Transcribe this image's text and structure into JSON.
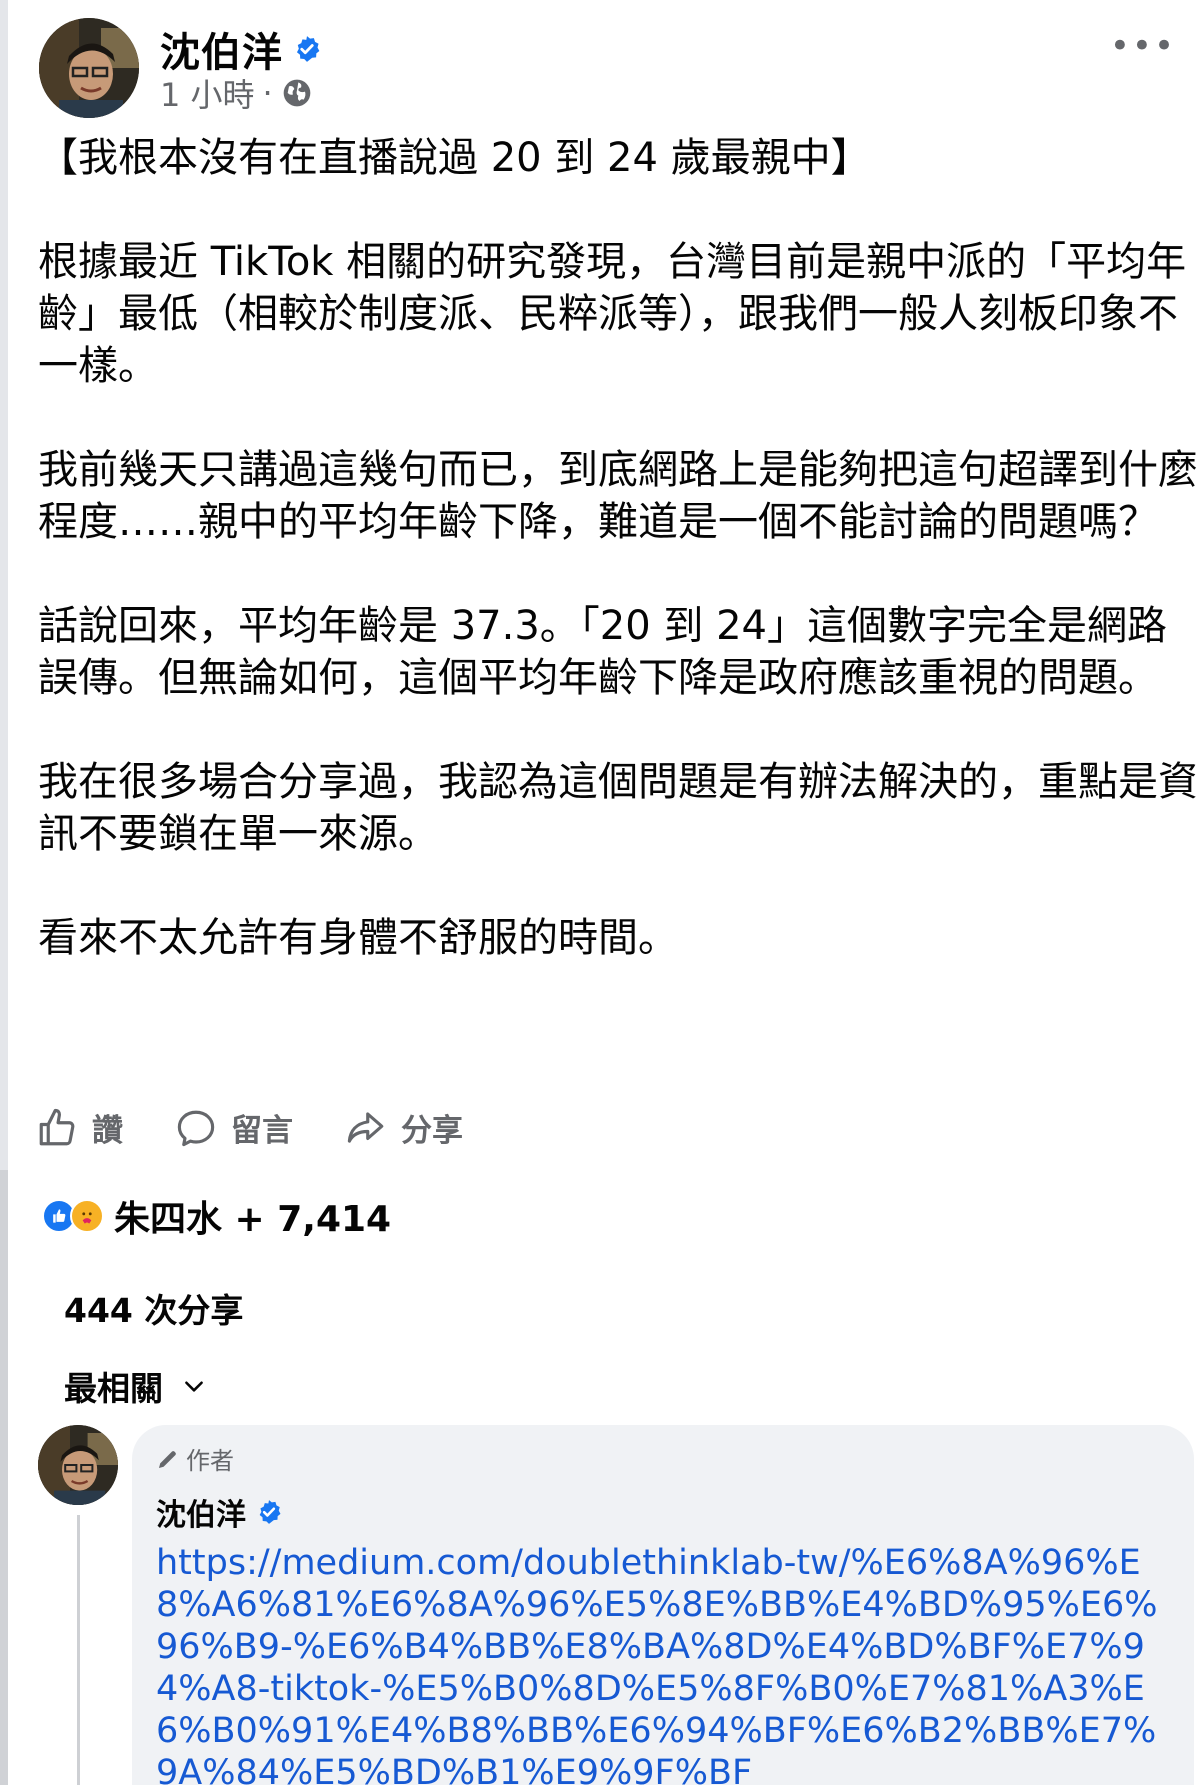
{
  "post": {
    "author": "沈伯洋",
    "time": "1 小時",
    "separator": "·",
    "more_label": "•••",
    "paragraphs": [
      "【我根本沒有在直播說過 20 到 24 歲最親中】",
      "根據最近 TikTok 相關的研究發現，台灣目前是親中派的「平均年齡」最低（相較於制度派、民粹派等），跟我們一般人刻板印象不一樣。",
      "我前幾天只講過這幾句而已，到底網路上是能夠把這句超譯到什麼程度……親中的平均年齡下降，難道是一個不能討論的問題嗎？",
      "話說回來，平均年齡是 37.3。「20 到 24」這個數字完全是網路誤傳。但無論如何，這個平均年齡下降是政府應該重視的問題。",
      "我在很多場合分享過，我認為這個問題是有辦法解決的，重點是資訊不要鎖在單一來源。",
      "看來不太允許有身體不舒服的時間。"
    ]
  },
  "actions": {
    "like": "讚",
    "comment": "留言",
    "share": "分享"
  },
  "reactions": {
    "summary": "朱四水 + 7,414"
  },
  "shares": "444 次分享",
  "sort": {
    "label": "最相關"
  },
  "comment": {
    "badge": "作者",
    "author": "沈伯洋",
    "link": "https://medium.com/doublethinklab-tw/%E6%8A%96%E8%A6%81%E6%8A%96%E5%8E%BB%E4%BD%95%E6%96%B9-%E6%B4%BB%E8%BA%8D%E4%BD%BF%E7%94%A8-tiktok-%E5%B0%8D%E5%8F%B0%E7%81%A3%E6%B0%91%E4%B8%BB%E6%94%BF%E6%B2%BB%E7%9A%84%E5%BD%B1%E9%9F%BF"
  },
  "colors": {
    "verified": "#1877f2",
    "link": "#1659d3",
    "secondary_text": "#65676b",
    "comment_bg": "#f0f2f5"
  }
}
